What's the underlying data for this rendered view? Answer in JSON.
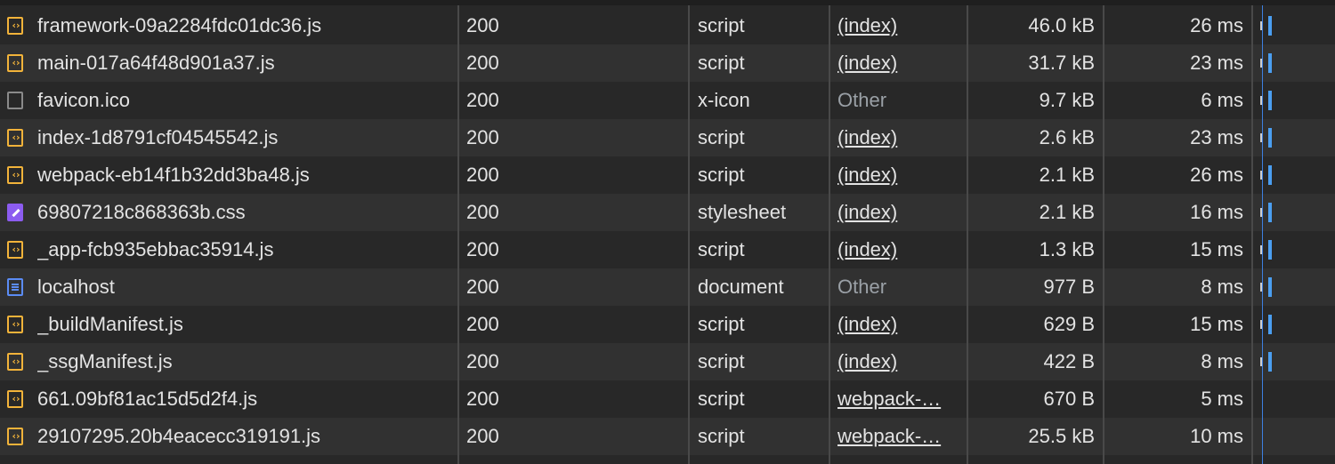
{
  "colors": {
    "background": "#282828",
    "row_alt": "#313131",
    "script_icon": "#f2b33a",
    "css_icon": "#8c5cf0",
    "document_icon": "#5b8cf5",
    "waterfall_bar": "#4a9ef0",
    "timeline_marker": "#3d7fe0"
  },
  "requests": [
    {
      "icon": "script-icon",
      "name": "framework-09a2284fdc01dc36.js",
      "status": "200",
      "type": "script",
      "initiator": "(index)",
      "initiator_link": true,
      "size": "46.0 kB",
      "time": "26 ms",
      "waterfall": true
    },
    {
      "icon": "script-icon",
      "name": "main-017a64f48d901a37.js",
      "status": "200",
      "type": "script",
      "initiator": "(index)",
      "initiator_link": true,
      "size": "31.7 kB",
      "time": "23 ms",
      "waterfall": true
    },
    {
      "icon": "blank-file-icon",
      "name": "favicon.ico",
      "status": "200",
      "type": "x-icon",
      "initiator": "Other",
      "initiator_link": false,
      "size": "9.7 kB",
      "time": "6 ms",
      "waterfall": true
    },
    {
      "icon": "script-icon",
      "name": "index-1d8791cf04545542.js",
      "status": "200",
      "type": "script",
      "initiator": "(index)",
      "initiator_link": true,
      "size": "2.6 kB",
      "time": "23 ms",
      "waterfall": true
    },
    {
      "icon": "script-icon",
      "name": "webpack-eb14f1b32dd3ba48.js",
      "status": "200",
      "type": "script",
      "initiator": "(index)",
      "initiator_link": true,
      "size": "2.1 kB",
      "time": "26 ms",
      "waterfall": true
    },
    {
      "icon": "stylesheet-icon",
      "name": "69807218c868363b.css",
      "status": "200",
      "type": "stylesheet",
      "initiator": "(index)",
      "initiator_link": true,
      "size": "2.1 kB",
      "time": "16 ms",
      "waterfall": true
    },
    {
      "icon": "script-icon",
      "name": "_app-fcb935ebbac35914.js",
      "status": "200",
      "type": "script",
      "initiator": "(index)",
      "initiator_link": true,
      "size": "1.3 kB",
      "time": "15 ms",
      "waterfall": true
    },
    {
      "icon": "document-icon",
      "name": "localhost",
      "status": "200",
      "type": "document",
      "initiator": "Other",
      "initiator_link": false,
      "size": "977 B",
      "time": "8 ms",
      "waterfall": true
    },
    {
      "icon": "script-icon",
      "name": "_buildManifest.js",
      "status": "200",
      "type": "script",
      "initiator": "(index)",
      "initiator_link": true,
      "size": "629 B",
      "time": "15 ms",
      "waterfall": true
    },
    {
      "icon": "script-icon",
      "name": "_ssgManifest.js",
      "status": "200",
      "type": "script",
      "initiator": "(index)",
      "initiator_link": true,
      "size": "422 B",
      "time": "8 ms",
      "waterfall": true
    },
    {
      "icon": "script-icon",
      "name": "661.09bf81ac15d5d2f4.js",
      "status": "200",
      "type": "script",
      "initiator": "webpack-…",
      "initiator_link": true,
      "size": "670 B",
      "time": "5 ms",
      "waterfall": false
    },
    {
      "icon": "script-icon",
      "name": "29107295.20b4eacecc319191.js",
      "status": "200",
      "type": "script",
      "initiator": "webpack-…",
      "initiator_link": true,
      "size": "25.5 kB",
      "time": "10 ms",
      "waterfall": false
    }
  ]
}
